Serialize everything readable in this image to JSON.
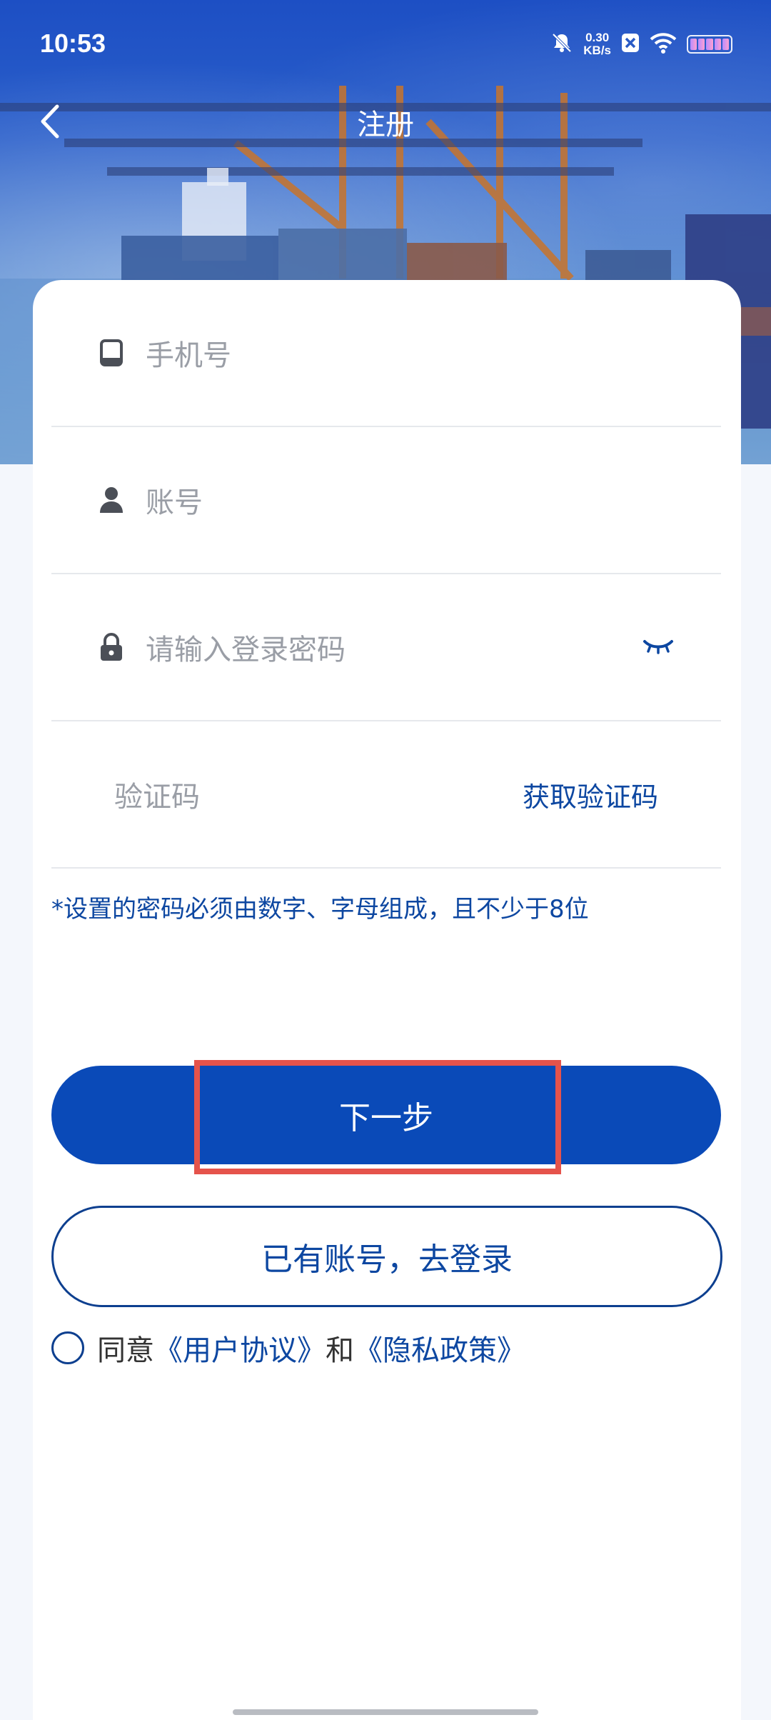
{
  "status_bar": {
    "time": "10:53",
    "net_speed_value": "0.30",
    "net_speed_unit": "KB/s",
    "icons": [
      "mute-bell-icon",
      "close-box-icon",
      "wifi-icon",
      "battery-icon"
    ]
  },
  "nav": {
    "title": "注册",
    "back_icon": "chevron-left-icon"
  },
  "form": {
    "phone_placeholder": "手机号",
    "account_placeholder": "账号",
    "password_placeholder": "请输入登录密码",
    "code_placeholder": "验证码",
    "get_code_label": "获取验证码",
    "password_hint": "*设置的密码必须由数字、字母组成，且不少于8位"
  },
  "buttons": {
    "next_label": "下一步",
    "login_label": "已有账号，去登录"
  },
  "agreement": {
    "prefix": "同意",
    "user_agreement": "《用户协议》",
    "connector": "和",
    "privacy_policy": "《隐私政策》",
    "checked": false
  },
  "colors": {
    "primary": "#0a4ab8",
    "link": "#0d47a1",
    "highlight_box": "#e5534b",
    "placeholder": "#9a9ea6"
  }
}
